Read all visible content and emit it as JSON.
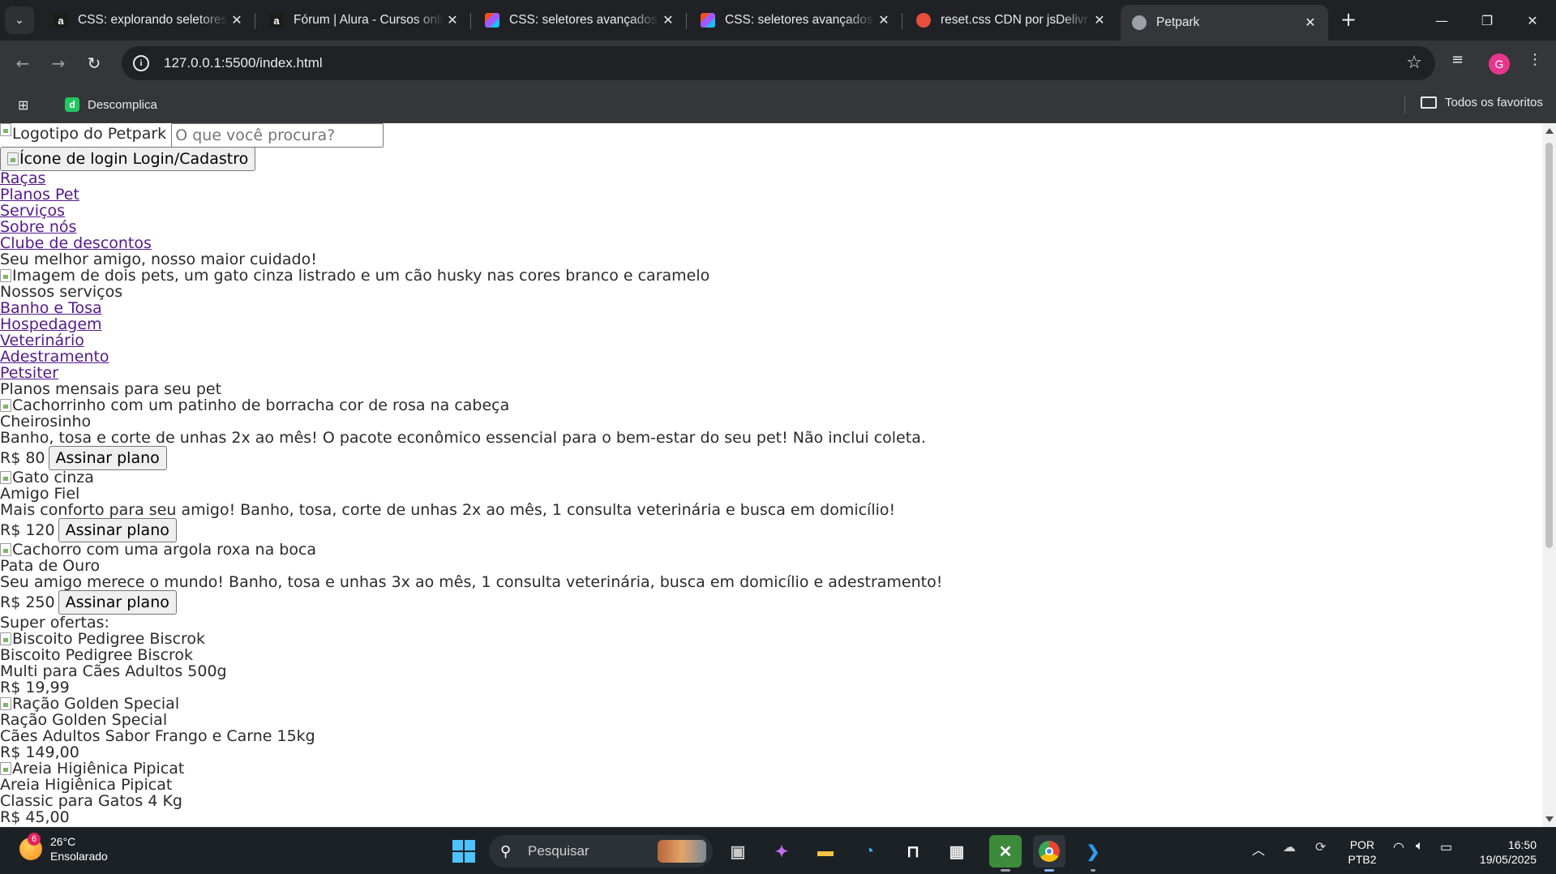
{
  "browser": {
    "tabs": [
      {
        "title": "CSS: explorando seletores e...",
        "favicon": "alura-icon",
        "fav_color": "#1c1c1c",
        "fav_letter": "a"
      },
      {
        "title": "Fórum | Alura - Cursos onli...",
        "favicon": "alura-icon",
        "fav_color": "#1c1c1c",
        "fav_letter": "a"
      },
      {
        "title": "CSS: seletores avançados e...",
        "favicon": "figma-icon",
        "fav_color": "#a259ff",
        "fav_letter": ""
      },
      {
        "title": "CSS: seletores avançados e...",
        "favicon": "figma-icon",
        "fav_color": "#a259ff",
        "fav_letter": ""
      },
      {
        "title": "reset.css CDN por jsDelivr -...",
        "favicon": "jsdelivr-icon",
        "fav_color": "#e84d3d",
        "fav_letter": ""
      },
      {
        "title": "Petpark",
        "favicon": "globe-icon",
        "fav_color": "#9aa0a6",
        "fav_letter": ""
      }
    ],
    "url": "127.0.0.1:5500/index.html",
    "profile_initial": "G",
    "bookmarks": {
      "item": "Descomplica",
      "all": "Todos os favoritos"
    }
  },
  "page": {
    "header": {
      "logo_alt": "Logotipo do Petpark",
      "search_placeholder": "O que você procura?",
      "login_alt": "Ícone de login",
      "login_label": "Login/Cadastro"
    },
    "nav": [
      "Raças",
      "Planos Pet",
      "Serviços",
      "Sobre nós",
      "Clube de descontos"
    ],
    "hero": {
      "title": "Seu melhor amigo, nosso maior cuidado!",
      "image_alt": "Imagem de dois pets, um gato cinza listrado e um cão husky nas cores branco e caramelo"
    },
    "services": {
      "title": "Nossos serviços",
      "items": [
        "Banho e Tosa",
        "Hospedagem",
        "Veterinário",
        "Adestramento",
        "Petsiter"
      ]
    },
    "plans": {
      "title": "Planos mensais para seu pet",
      "button_label": "Assinar plano",
      "items": [
        {
          "image_alt": "Cachorrinho com um patinho de borracha cor de rosa na cabeça",
          "name": "Cheirosinho",
          "desc": "Banho, tosa e corte de unhas 2x ao mês! O pacote econômico essencial para o bem-estar do seu pet! Não inclui coleta.",
          "price": "R$ 80"
        },
        {
          "image_alt": "Gato cinza",
          "name": "Amigo Fiel",
          "desc": "Mais conforto para seu amigo! Banho, tosa, corte de unhas 2x ao mês, 1 consulta veterinária e busca em domicílio!",
          "price": "R$ 120"
        },
        {
          "image_alt": "Cachorro com uma argola roxa na boca",
          "name": "Pata de Ouro",
          "desc": "Seu amigo merece o mundo! Banho, tosa e unhas 3x ao mês, 1 consulta veterinária, busca em domicílio e adestramento!",
          "price": "R$ 250"
        }
      ]
    },
    "offers": {
      "title": "Super ofertas:",
      "items": [
        {
          "image_alt": "Biscoito Pedigree Biscrok",
          "name": "Biscoito Pedigree Biscrok",
          "desc": "Multi para Cães Adultos 500g",
          "price": "R$ 19,99"
        },
        {
          "image_alt": "Ração Golden Special",
          "name": "Ração Golden Special",
          "desc": "Cães Adultos Sabor Frango e Carne 15kg",
          "price": "R$ 149,00"
        },
        {
          "image_alt": "Areia Higiênica Pipicat",
          "name": "Areia Higiênica Pipicat",
          "desc": "Classic para Gatos 4 Kg",
          "price": "R$ 45,00"
        }
      ]
    }
  },
  "taskbar": {
    "weather": {
      "temp": "26°C",
      "cond": "Ensolarado",
      "badge": "6"
    },
    "search_label": "Pesquisar",
    "lang": {
      "l1": "POR",
      "l2": "PTB2"
    },
    "clock": {
      "time": "16:50",
      "date": "19/05/2025"
    }
  }
}
